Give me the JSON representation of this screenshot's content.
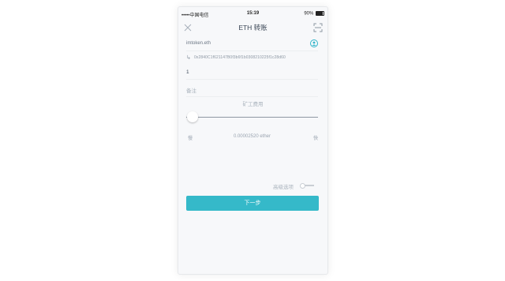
{
  "statusbar": {
    "carrier": "•••••中国电信",
    "time": "15:19",
    "battery": "90%",
    "battery_level": 0.9
  },
  "nav": {
    "title": "ETH 转账",
    "close_icon": "close-icon",
    "scan_icon": "scan-icon"
  },
  "form": {
    "receiver": "imtoken.eth",
    "resolved_address": "0x2840C1f621147B0f3b6f1b0308210225f1c28d60",
    "amount": "1",
    "memo_placeholder": "备注"
  },
  "fee": {
    "label": "矿工费用",
    "slow_label": "慢",
    "fast_label": "快",
    "amount": "0.00002520 ether",
    "slider_position": 0.05
  },
  "advanced": {
    "label": "高级选项",
    "enabled": false
  },
  "actions": {
    "next_label": "下一步"
  },
  "colors": {
    "accent": "#35b9c9",
    "text_primary": "#3b4756",
    "text_muted": "#aab3bd"
  }
}
